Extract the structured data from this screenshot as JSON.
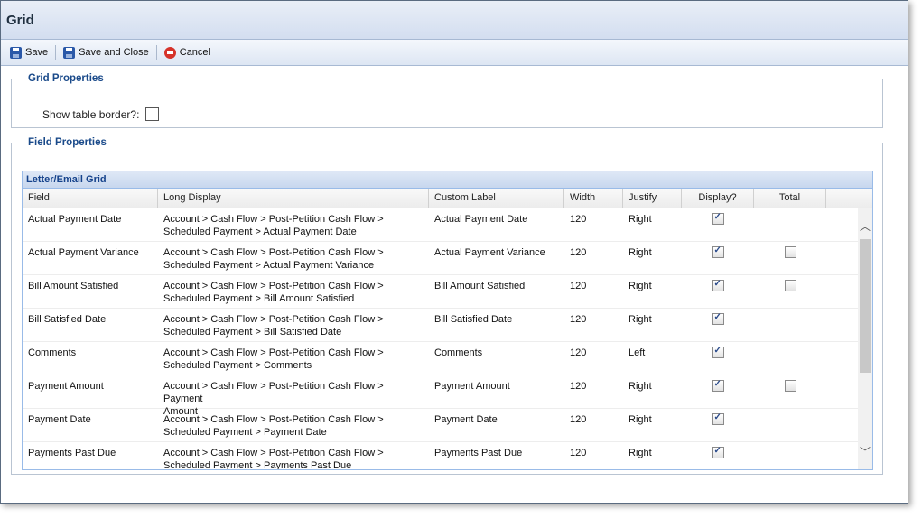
{
  "window": {
    "title": "Grid"
  },
  "toolbar": {
    "save": "Save",
    "save_close": "Save and Close",
    "cancel": "Cancel"
  },
  "grid_properties": {
    "legend": "Grid Properties",
    "show_border_label": "Show table border?:",
    "show_border_checked": false
  },
  "field_properties": {
    "legend": "Field Properties",
    "panel_title": "Letter/Email Grid",
    "columns": [
      "Field",
      "Long Display",
      "Custom Label",
      "Width",
      "Justify",
      "Display?",
      "Total"
    ],
    "rows": [
      {
        "field": "Actual Payment Date",
        "long1": "Account > Cash Flow > Post-Petition Cash Flow >",
        "long2": "Scheduled Payment > Actual Payment Date",
        "label": "Actual Payment Date",
        "width": "120",
        "justify": "Right",
        "display": true,
        "total": null
      },
      {
        "field": "Actual Payment Variance",
        "long1": "Account > Cash Flow > Post-Petition Cash Flow >",
        "long2": "Scheduled Payment > Actual Payment Variance",
        "label": "Actual Payment Variance",
        "width": "120",
        "justify": "Right",
        "display": true,
        "total": false
      },
      {
        "field": "Bill Amount Satisfied",
        "long1": "Account > Cash Flow > Post-Petition Cash Flow >",
        "long2": "Scheduled Payment > Bill Amount Satisfied",
        "label": "Bill Amount Satisfied",
        "width": "120",
        "justify": "Right",
        "display": true,
        "total": false
      },
      {
        "field": "Bill Satisfied Date",
        "long1": "Account > Cash Flow > Post-Petition Cash Flow >",
        "long2": "Scheduled Payment > Bill Satisfied Date",
        "label": "Bill Satisfied Date",
        "width": "120",
        "justify": "Right",
        "display": true,
        "total": null
      },
      {
        "field": "Comments",
        "long1": "Account > Cash Flow > Post-Petition Cash Flow >",
        "long2": "Scheduled Payment > Comments",
        "label": "Comments",
        "width": "120",
        "justify": "Left",
        "display": true,
        "total": null
      },
      {
        "field": "Payment Amount",
        "long1": "Account > Cash Flow > Post-Petition Cash Flow > Payment",
        "long2": "Amount",
        "label": "Payment Amount",
        "width": "120",
        "justify": "Right",
        "display": true,
        "total": false
      },
      {
        "field": "Payment Date",
        "long1": "Account > Cash Flow > Post-Petition Cash Flow >",
        "long2": "Scheduled Payment > Payment Date",
        "label": "Payment Date",
        "width": "120",
        "justify": "Right",
        "display": true,
        "total": null
      },
      {
        "field": "Payments Past Due",
        "long1": "Account > Cash Flow > Post-Petition Cash Flow >",
        "long2": "Scheduled Payment > Payments Past Due",
        "label": "Payments Past Due",
        "width": "120",
        "justify": "Right",
        "display": true,
        "total": null
      }
    ]
  },
  "icons": {
    "save": "floppy-disk-icon",
    "cancel": "cancel-icon",
    "scroll_up": "chevron-up-icon",
    "scroll_down": "chevron-down-icon"
  },
  "colors": {
    "accent": "#15428b",
    "legend": "#1a4a8a",
    "cancel": "#d6332a"
  }
}
